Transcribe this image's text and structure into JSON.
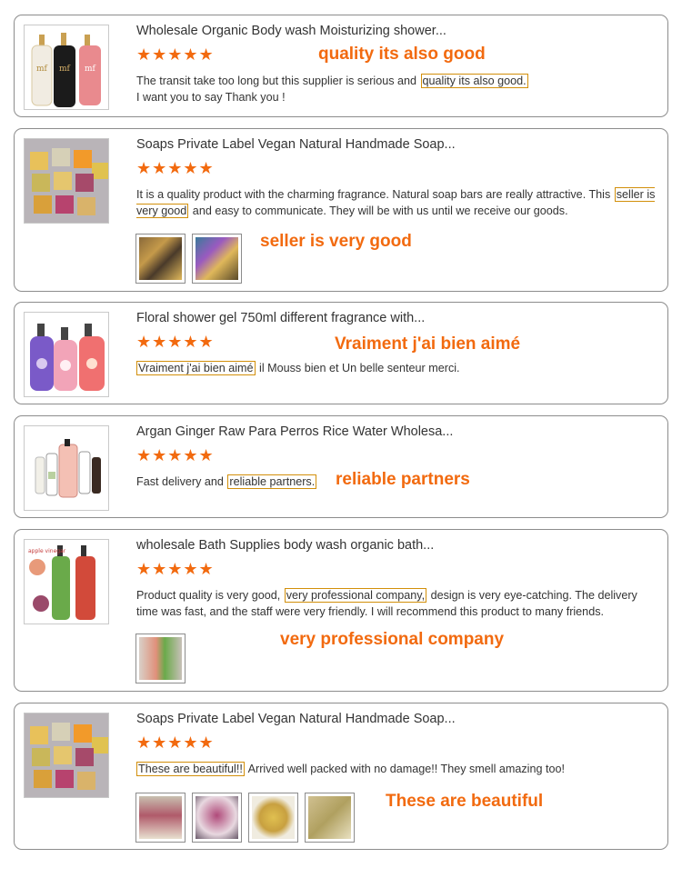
{
  "reviews": [
    {
      "title": "Wholesale Organic Body wash Moisturizing shower...",
      "stars": "★★★★★",
      "before": "The transit take too long but this supplier is serious and ",
      "highlight": "quality its also good.",
      "after": "",
      "line2": "I want you to say Thank you !",
      "callout": "quality its also good"
    },
    {
      "title": "Soaps Private Label Vegan Natural Handmade Soap...",
      "stars": "★★★★★",
      "before": "It is a quality product with the charming fragrance. Natural soap bars are really attractive. This ",
      "highlight": "seller is very good",
      "after": " and easy to communicate. They will be with us until we receive our goods.",
      "callout": "seller is very good"
    },
    {
      "title": "Floral shower gel 750ml different fragrance with...",
      "stars": "★★★★★",
      "before": "",
      "highlight": "Vraiment j'ai bien aimé",
      "after": " il Mouss bien et Un belle senteur merci.",
      "callout": "Vraiment j'ai bien aimé"
    },
    {
      "title": "Argan Ginger Raw Para Perros Rice Water Wholesa...",
      "stars": "★★★★★",
      "before": "Fast delivery and ",
      "highlight": "reliable partners.",
      "after": "",
      "callout": "reliable partners"
    },
    {
      "title": "wholesale Bath Supplies body wash organic bath...",
      "stars": "★★★★★",
      "before": "Product quality is very good, ",
      "highlight": "very professional company,",
      "after": " design is very eye-catching. The delivery time was fast, and the staff were very friendly. I will recommend this product to many friends.",
      "callout": "very professional company"
    },
    {
      "title": "Soaps Private Label Vegan Natural Handmade Soap...",
      "stars": "★★★★★",
      "before": "",
      "highlight": "These are beautiful!!",
      "after": " Arrived well packed with no damage!! They smell amazing too!",
      "callout": "These are beautiful"
    }
  ],
  "colors": {
    "accent": "#f26a0f",
    "highlight_border": "#d28f0a",
    "card_border": "#8c8c8c"
  }
}
